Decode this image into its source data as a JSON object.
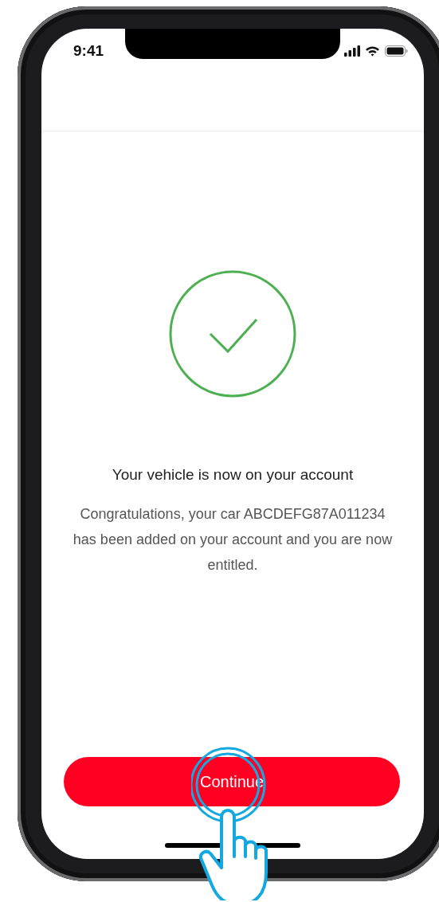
{
  "status_bar": {
    "time": "9:41"
  },
  "title": "Your vehicle is now on your account",
  "message": "Congratulations, your car ABCDEFG87A011234 has been added on your account and you are now entitled.",
  "button": {
    "label": "Continue"
  }
}
